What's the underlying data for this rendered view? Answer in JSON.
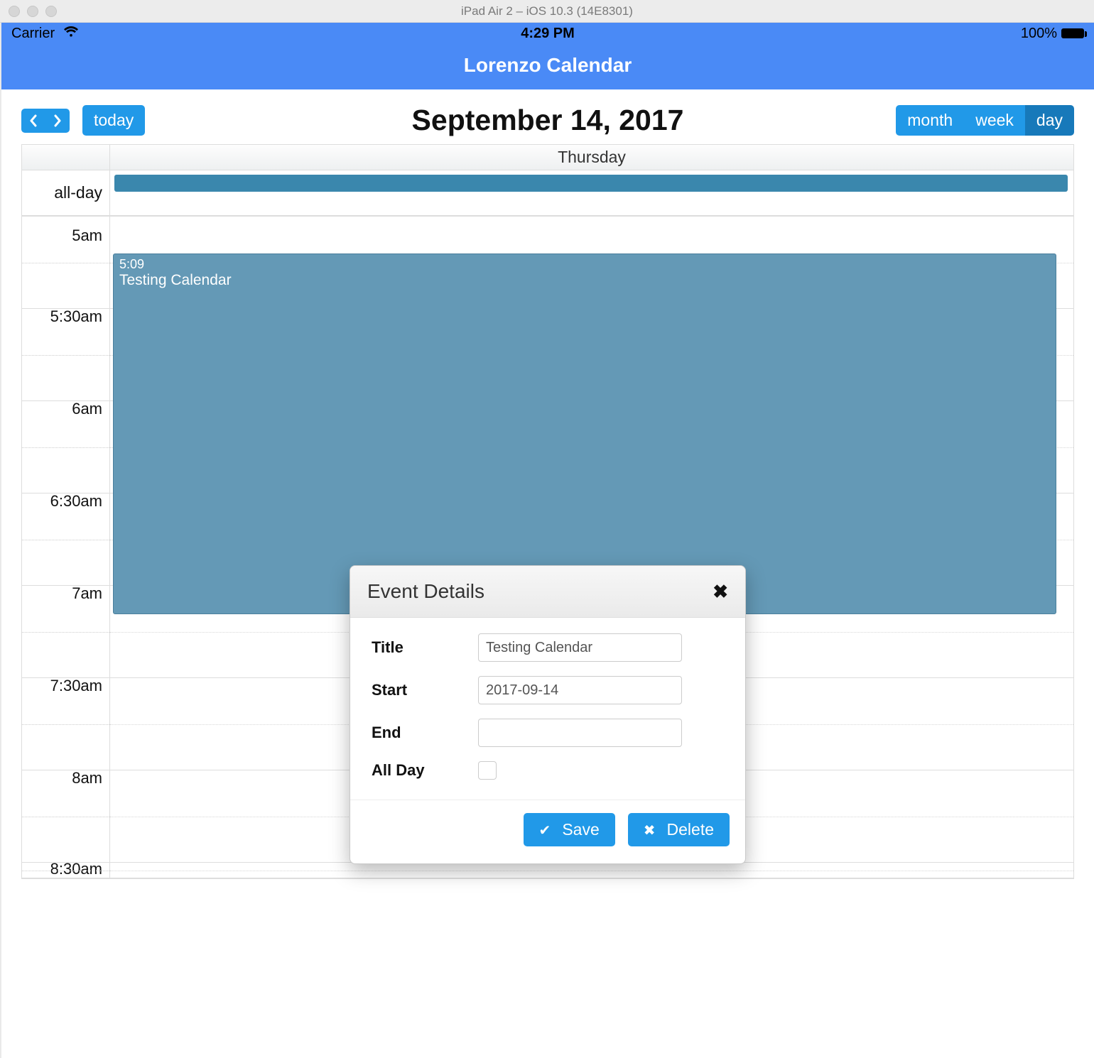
{
  "simulator": {
    "title": "iPad Air 2 – iOS 10.3 (14E8301)"
  },
  "status_bar": {
    "carrier": "Carrier",
    "time": "4:29 PM",
    "battery_pct": "100%"
  },
  "app": {
    "title": "Lorenzo Calendar"
  },
  "toolbar": {
    "today_label": "today",
    "date_title": "September 14, 2017",
    "views": {
      "month": "month",
      "week": "week",
      "day": "day"
    },
    "active_view": "day"
  },
  "grid": {
    "day_header": "Thursday",
    "allday_label": "all-day",
    "time_labels": [
      "5am",
      "5:30am",
      "6am",
      "6:30am",
      "7am",
      "7:30am",
      "8am"
    ],
    "bottom_peek_label": "8:30am"
  },
  "event": {
    "start_display": "5:09",
    "title": "Testing Calendar"
  },
  "modal": {
    "title": "Event Details",
    "labels": {
      "title": "Title",
      "start": "Start",
      "end": "End",
      "allday": "All Day"
    },
    "values": {
      "title": "Testing Calendar",
      "start": "2017-09-14",
      "end": "",
      "allday_checked": false
    },
    "buttons": {
      "save": "Save",
      "delete": "Delete"
    }
  }
}
